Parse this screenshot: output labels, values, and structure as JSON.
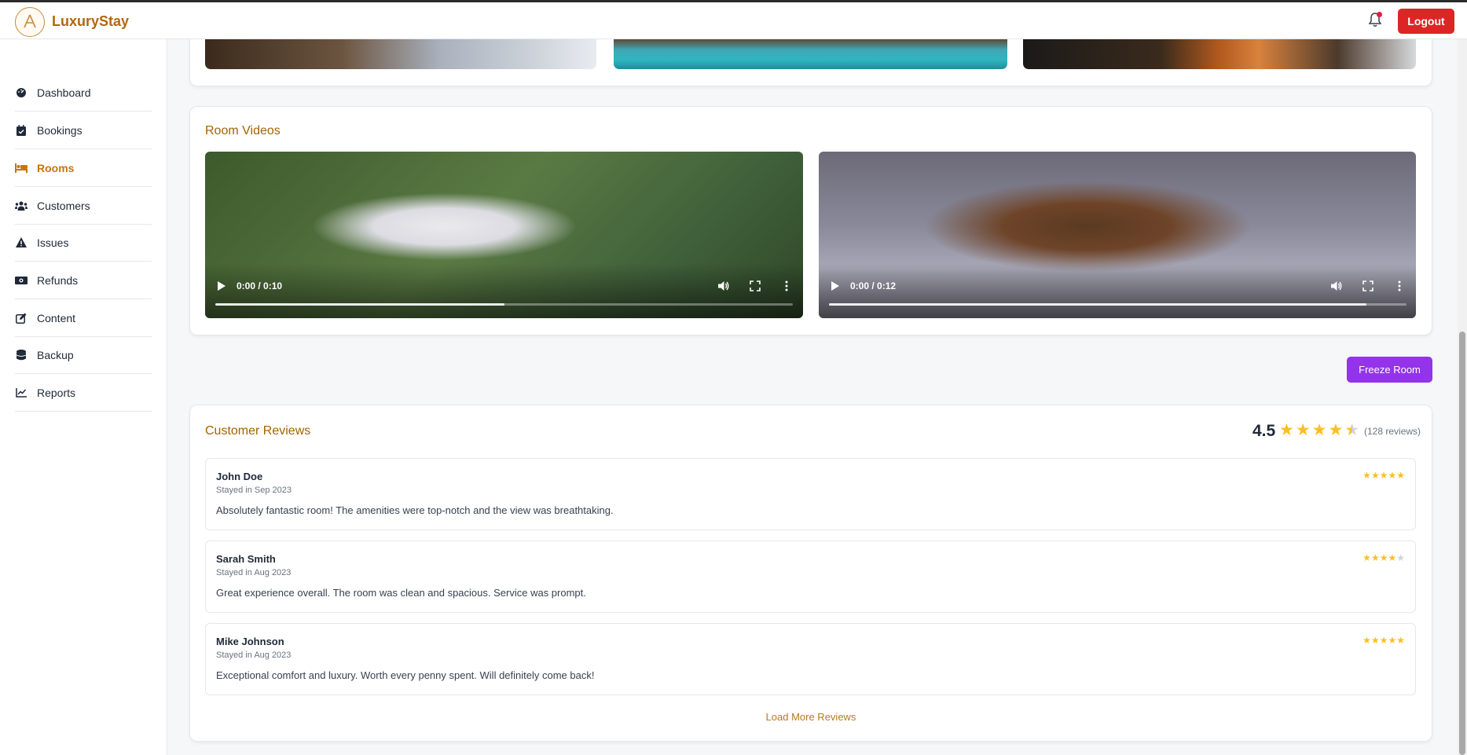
{
  "header": {
    "brand": "LuxuryStay",
    "logout_label": "Logout"
  },
  "sidebar": {
    "items": [
      {
        "label": "Dashboard",
        "icon": "dashboard-icon",
        "active": false
      },
      {
        "label": "Bookings",
        "icon": "calendar-check-icon",
        "active": false
      },
      {
        "label": "Rooms",
        "icon": "bed-icon",
        "active": true
      },
      {
        "label": "Customers",
        "icon": "users-icon",
        "active": false
      },
      {
        "label": "Issues",
        "icon": "warning-icon",
        "active": false
      },
      {
        "label": "Refunds",
        "icon": "money-icon",
        "active": false
      },
      {
        "label": "Content",
        "icon": "edit-icon",
        "active": false
      },
      {
        "label": "Backup",
        "icon": "database-icon",
        "active": false
      },
      {
        "label": "Reports",
        "icon": "chart-line-icon",
        "active": false
      }
    ]
  },
  "videos": {
    "title": "Room Videos",
    "items": [
      {
        "time": "0:00 / 0:10",
        "progress": 0.5
      },
      {
        "time": "0:00 / 0:12",
        "progress": 0.93
      }
    ]
  },
  "actions": {
    "freeze_label": "Freeze Room"
  },
  "reviews": {
    "title": "Customer Reviews",
    "average": "4.5",
    "average_stars": 4.5,
    "count_label": "(128 reviews)",
    "items": [
      {
        "name": "John Doe",
        "stay": "Stayed in Sep 2023",
        "text": "Absolutely fantastic room! The amenities were top-notch and the view was breathtaking.",
        "stars": 5
      },
      {
        "name": "Sarah Smith",
        "stay": "Stayed in Aug 2023",
        "text": "Great experience overall. The room was clean and spacious. Service was prompt.",
        "stars": 4
      },
      {
        "name": "Mike Johnson",
        "stay": "Stayed in Aug 2023",
        "text": "Exceptional comfort and luxury. Worth every penny spent. Will definitely come back!",
        "stars": 5
      }
    ],
    "load_more_label": "Load More Reviews"
  },
  "colors": {
    "accent": "#b3670c",
    "logout": "#dc2626",
    "freeze": "#9333ea",
    "star": "#fbbf24"
  }
}
